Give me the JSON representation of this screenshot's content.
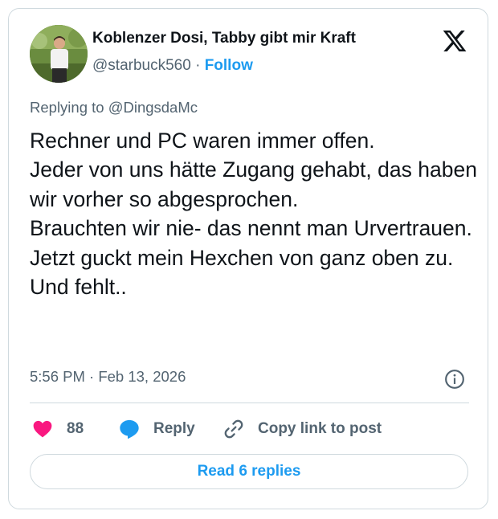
{
  "author": {
    "display_name": "Koblenzer Dosi, Tabby gibt mir Kraft",
    "handle": "@starbuck560",
    "separator": "·",
    "follow_label": "Follow"
  },
  "brand": {
    "icon": "x-logo-icon"
  },
  "tweet": {
    "replying_to": "Replying to @DingsdaMc",
    "text": "Rechner und PC waren immer offen.\nJeder von uns hätte Zugang gehabt, das haben wir vorher so abgesprochen.\nBrauchten wir nie- das nennt man Urvertrauen.\nJetzt guckt mein Hexchen von ganz oben zu.\nUnd fehlt..",
    "timestamp": "5:56 PM · Feb 13, 2026"
  },
  "actions": {
    "like_count": "88",
    "reply_label": "Reply",
    "copy_link_label": "Copy link to post"
  },
  "footer": {
    "read_replies_label": "Read 6 replies"
  },
  "colors": {
    "accent": "#1d9bf0",
    "like": "#f91880",
    "muted": "#536471",
    "text": "#0f1419",
    "border": "#cfd9de"
  }
}
